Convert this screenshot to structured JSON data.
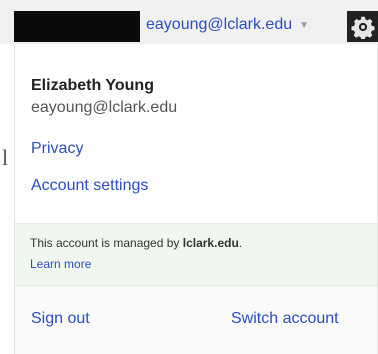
{
  "top_bar": {
    "account_email": "eayoung@lclark.edu",
    "dropdown_icon": "chevron-down-icon",
    "settings_icon": "gear-icon"
  },
  "account_menu": {
    "name": "Elizabeth Young",
    "email": "eayoung@lclark.edu",
    "links": {
      "privacy": "Privacy",
      "account_settings": "Account settings"
    },
    "managed_notice": {
      "prefix": "This account is managed by ",
      "domain": "lclark.edu",
      "suffix": ".",
      "learn_more": "Learn more"
    },
    "footer": {
      "sign_out": "Sign out",
      "switch_account": "Switch account"
    }
  },
  "background_text": {
    "fragment": "l"
  },
  "colors": {
    "link": "#2a4fbf",
    "managed_background": "#f0f7ee",
    "footer_background": "#fafafa",
    "top_bar_background": "#f1f1f1"
  }
}
